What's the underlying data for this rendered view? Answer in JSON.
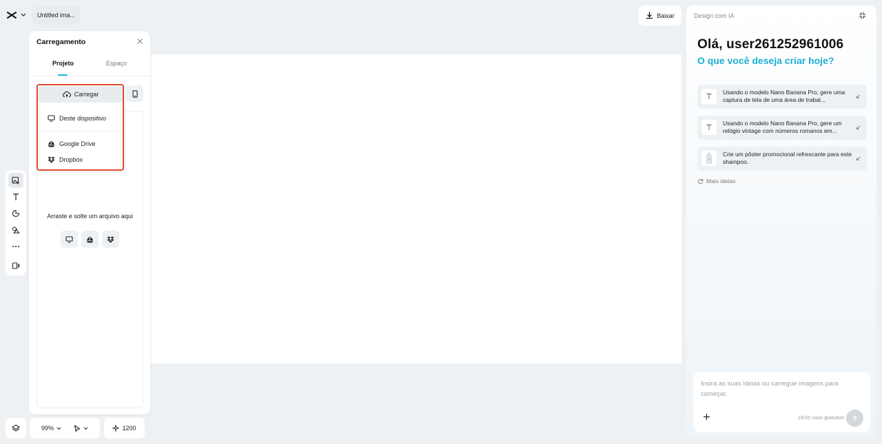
{
  "topbar": {
    "document_title": "Untitled ima...",
    "download_label": "Baixar"
  },
  "upload_panel": {
    "title": "Carregamento",
    "tabs": [
      {
        "label": "Projeto",
        "active": true
      },
      {
        "label": "Espaço",
        "active": false
      }
    ],
    "upload_button_label": "Carregar",
    "menu_items": [
      {
        "label": "Deste dispositivo",
        "icon": "monitor-icon"
      },
      {
        "label": "Google Drive",
        "icon": "google-drive-icon"
      },
      {
        "label": "Dropbox",
        "icon": "dropbox-icon"
      }
    ],
    "drop_text": "Arraste e solte um arquivo aqui"
  },
  "bottom_bar": {
    "zoom": "99%",
    "credits": "1200"
  },
  "ai_panel": {
    "header": "Design com IA",
    "greeting": "Olá, user261252961006",
    "subtitle": "O que você deseja criar hoje?",
    "ideas": [
      {
        "text": "Usando o modelo Nano Banana Pro, gere uma captura de tela de uma área de trabal...",
        "icon": "text-icon"
      },
      {
        "text": "Usando o modelo Nano Banana Pro, gere um relógio vintage com números romanos em...",
        "icon": "text-icon"
      },
      {
        "text": "Crie um pôster promocional refrescante para este shampoo.",
        "icon": "shampoo-thumbnail"
      }
    ],
    "more_ideas_label": "Mais ideias",
    "prompt_placeholder": "Insira as suas ideias ou carregue imagens para começar.",
    "usage_text": "10/10 usos gratuitos"
  },
  "colors": {
    "accent": "#1bb0d4",
    "highlight_border": "#e04a2f",
    "background": "#eef1f4"
  }
}
